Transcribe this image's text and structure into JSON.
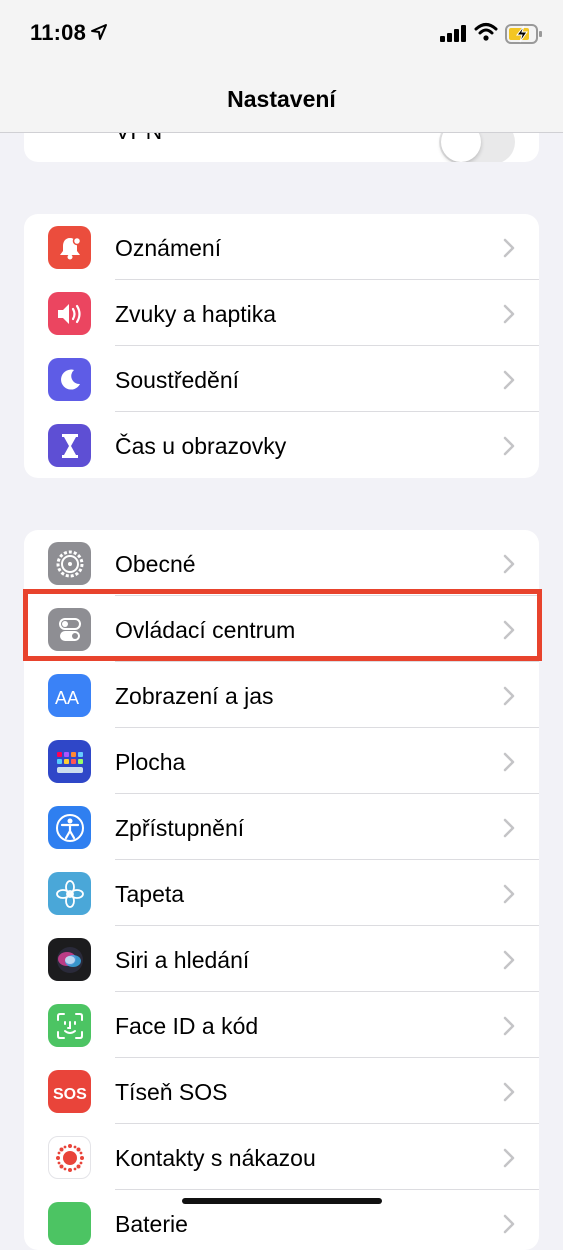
{
  "status": {
    "time": "11:08"
  },
  "nav": {
    "title": "Nastavení"
  },
  "vpn": {
    "label": "VPN",
    "toggle_on": false
  },
  "group1": [
    {
      "label": "Oznámení",
      "icon": "notifications-icon",
      "color": "#eb4d3d"
    },
    {
      "label": "Zvuky a haptika",
      "icon": "sound-icon",
      "color": "#eb4560"
    },
    {
      "label": "Soustředění",
      "icon": "moon-icon",
      "color": "#5e5ce6"
    },
    {
      "label": "Čas u obrazovky",
      "icon": "hourglass-icon",
      "color": "#5e4fd4"
    }
  ],
  "group2": [
    {
      "label": "Obecné",
      "icon": "gear-icon",
      "color": "#8e8e93"
    },
    {
      "label": "Ovládací centrum",
      "icon": "control-center-icon",
      "color": "#8e8e93"
    },
    {
      "label": "Zobrazení a jas",
      "icon": "display-icon",
      "color": "#3a82f7"
    },
    {
      "label": "Plocha",
      "icon": "home-screen-icon",
      "color": "#2f47c8"
    },
    {
      "label": "Zpřístupnění",
      "icon": "accessibility-icon",
      "color": "#2f7ff0"
    },
    {
      "label": "Tapeta",
      "icon": "wallpaper-icon",
      "color": "#4aa7d8"
    },
    {
      "label": "Siri a hledání",
      "icon": "siri-icon",
      "color": "#1c1c1e"
    },
    {
      "label": "Face ID a kód",
      "icon": "face-id-icon",
      "color": "#4cc463"
    },
    {
      "label": "Tíseň SOS",
      "icon": "sos-icon",
      "color": "#e9443a"
    },
    {
      "label": "Kontakty s nákazou",
      "icon": "exposure-icon",
      "color": "#ffffff"
    },
    {
      "label": "Baterie",
      "icon": "battery-icon",
      "color": "#4cc463"
    }
  ],
  "colors": {
    "highlight": "#e8432d",
    "background": "#f2f2f7"
  }
}
